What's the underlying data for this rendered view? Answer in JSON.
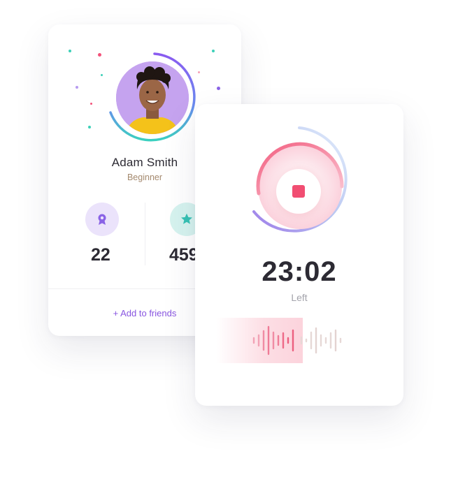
{
  "profile": {
    "name": "Adam Smith",
    "level": "Beginner",
    "stats": [
      {
        "icon": "award-icon",
        "value": "22",
        "color": "#8a63e6",
        "bg": "#ebe3fb"
      },
      {
        "icon": "star-icon",
        "value": "459",
        "color": "#36c2b4",
        "bg": "#d6f3ef"
      }
    ],
    "add_friends": "+ Add to friends",
    "avatar_bg": "#c5a3ef"
  },
  "timer": {
    "time": "23:02",
    "label": "Left",
    "stop_icon": "stop-icon",
    "accent": "#f14e72",
    "progress": 0.62
  }
}
